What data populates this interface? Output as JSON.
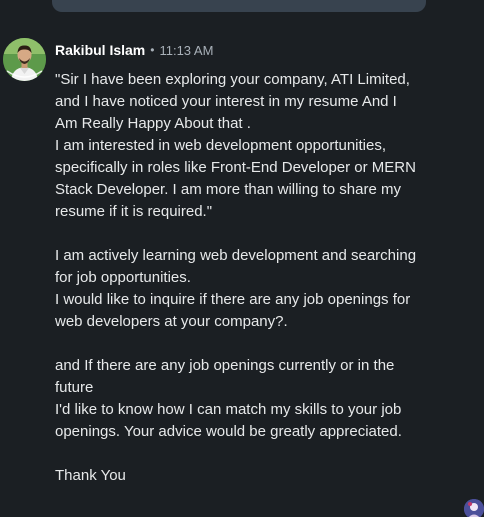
{
  "colors": {
    "background": "#1b1f23",
    "text_primary": "#e7e9ea",
    "text_secondary": "#a8b0b8",
    "bubble": "#38434f"
  },
  "message": {
    "sender_name": "Rakibul Islam",
    "separator": "•",
    "timestamp": "11:13 AM",
    "avatar_icon": "profile-photo",
    "lines": [
      "\"Sir I have been exploring your company, ATI Limited,",
      "and I have noticed your interest in my resume And I",
      "Am Really Happy About that .",
      "I am interested in web development opportunities,",
      "specifically in roles like Front-End Developer or MERN",
      "Stack Developer. I am more than willing to share my",
      "resume if it is required.\"",
      "",
      "I am actively learning web development and searching",
      "for job opportunities.",
      "I would like to inquire if there are any job openings for",
      "web developers at your company?.",
      "",
      "and If there are any job openings currently or in the",
      "future",
      "I'd like to know how I can match my skills to your job",
      "openings. Your advice would be greatly appreciated.",
      "",
      "Thank You"
    ]
  },
  "corner_avatar_icon": "user-avatar"
}
